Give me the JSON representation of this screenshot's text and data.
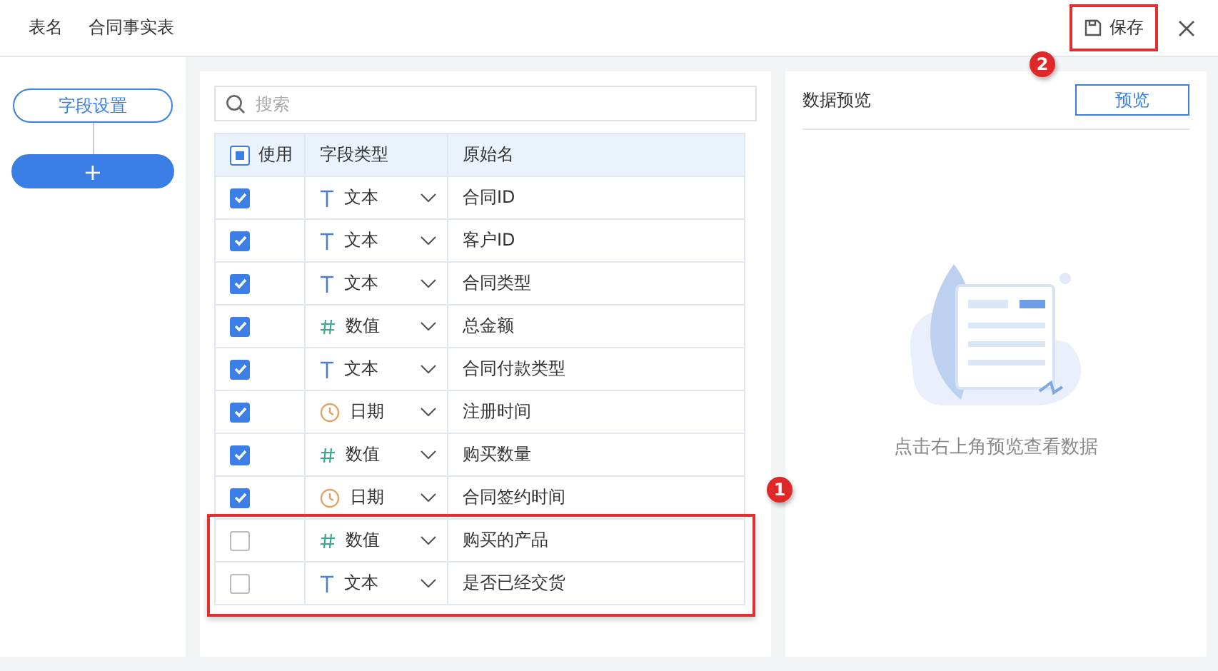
{
  "header": {
    "label": "表名",
    "table_name": "合同事实表",
    "save": {
      "label": "保存",
      "highlighted": true,
      "callout": "2"
    }
  },
  "sidebar": {
    "tab": "字段设置",
    "add_button": "+"
  },
  "search": {
    "placeholder": "搜索"
  },
  "table": {
    "columns": [
      "使用",
      "字段类型",
      "原始名"
    ],
    "select_all": {
      "indeterminate": true
    },
    "rows": [
      {
        "checked": true,
        "kind": "text",
        "type": "文本",
        "name": "合同ID"
      },
      {
        "checked": true,
        "kind": "text",
        "type": "文本",
        "name": "客户ID"
      },
      {
        "checked": true,
        "kind": "text",
        "type": "文本",
        "name": "合同类型"
      },
      {
        "checked": true,
        "kind": "number",
        "type": "数值",
        "name": "总金额"
      },
      {
        "checked": true,
        "kind": "text",
        "type": "文本",
        "name": "合同付款类型"
      },
      {
        "checked": true,
        "kind": "date",
        "type": "日期",
        "name": "注册时间"
      },
      {
        "checked": true,
        "kind": "number",
        "type": "数值",
        "name": "购买数量"
      },
      {
        "checked": true,
        "kind": "date",
        "type": "日期",
        "name": "合同签约时间"
      },
      {
        "checked": false,
        "kind": "number",
        "type": "数值",
        "name": "购买的产品",
        "highlighted": true
      },
      {
        "checked": false,
        "kind": "text",
        "type": "文本",
        "name": "是否已经交货",
        "highlighted": true
      }
    ],
    "highlight": {
      "callout": "1"
    }
  },
  "preview": {
    "title": "数据预览",
    "button": "预览",
    "empty_text": "点击右上角预览查看数据"
  }
}
